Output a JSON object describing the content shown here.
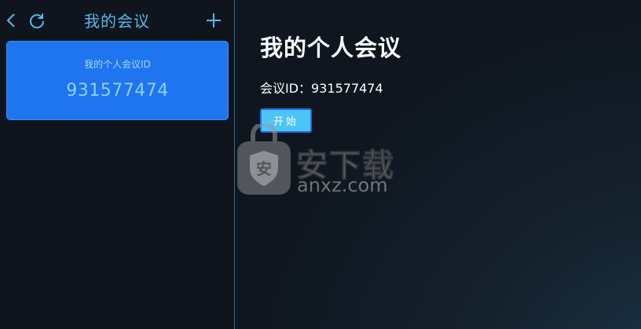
{
  "sidebar": {
    "title": "我的会议",
    "back_icon": "chevron-left-icon",
    "refresh_icon": "refresh-icon",
    "add_icon": "plus-icon",
    "accent_color": "#54b9ee",
    "card": {
      "label": "我的个人会议ID",
      "meeting_id": "931577474",
      "background": "#1f74f0"
    }
  },
  "main": {
    "title": "我的个人会议",
    "meeting_id_line": "会议ID：931577474",
    "start_label": "开始",
    "start_button_color": "#4cc4f6"
  },
  "watermark": {
    "text_cn": "安下载",
    "text_en": "anxz.com",
    "shield_char": "安"
  }
}
